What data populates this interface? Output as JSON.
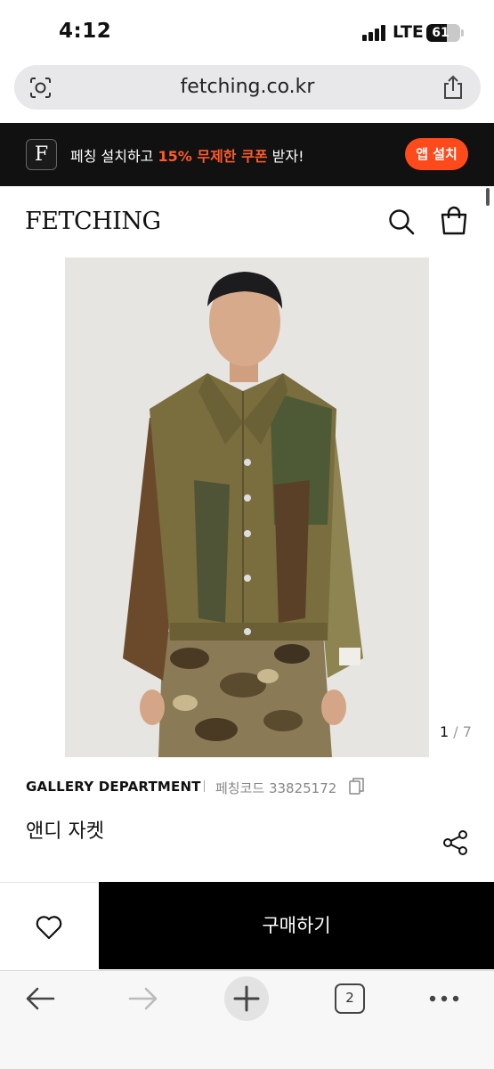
{
  "status_bar": {
    "time": "4:12",
    "network": "LTE",
    "battery": "61",
    "battery_level": 0.61
  },
  "browser": {
    "url": "fetching.co.kr",
    "toolbar": {
      "open_tabs": "2"
    }
  },
  "promo_banner": {
    "logo_letter": "F",
    "text_before": "페칭 설치하고 ",
    "highlight": "15% 무제한 쿠폰",
    "text_after": " 받자!",
    "install_label": "앱 설치"
  },
  "header": {
    "logo": "FETCHING",
    "icons": [
      "search-icon",
      "shopping-bag-icon"
    ]
  },
  "product": {
    "image_counter": {
      "current": "1",
      "separator": " / ",
      "total": "7"
    },
    "brand": "GALLERY DEPARTMENT",
    "code_label": "페칭코드 33825172",
    "name": "앤디 자켓"
  },
  "actions": {
    "buy_label": "구매하기"
  },
  "colors": {
    "promo_bg": "#111111",
    "accent": "#ff4a1c",
    "buy_bg": "#000000"
  }
}
